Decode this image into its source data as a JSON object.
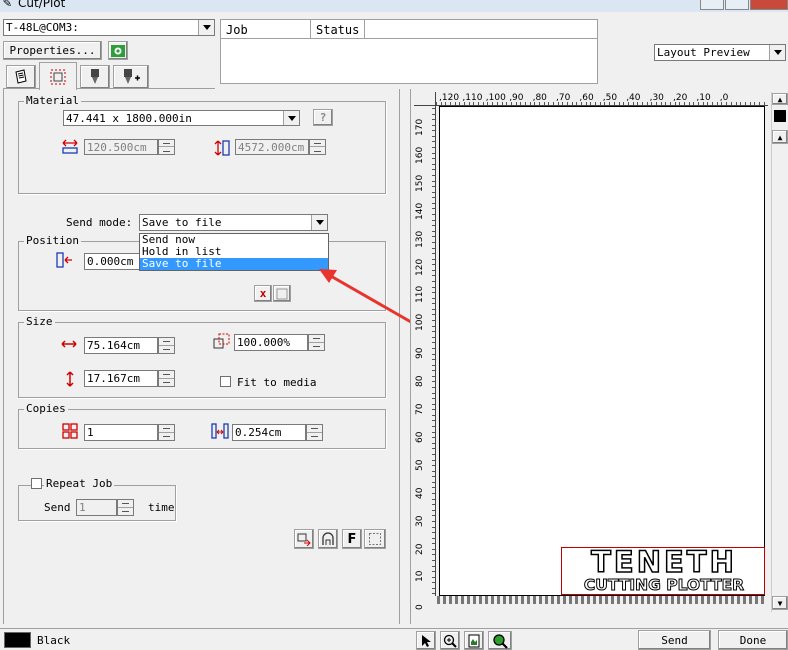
{
  "window": {
    "title": "Cut/Plot"
  },
  "device": {
    "selected": "T-48L@COM3:"
  },
  "toolbar": {
    "properties_label": "Properties..."
  },
  "queue": {
    "columns": [
      "Job",
      "Status"
    ]
  },
  "preview_mode": {
    "selected": "Layout Preview"
  },
  "material": {
    "legend": "Material",
    "size_selected": "47.441 x 1800.000in",
    "width": "120.500cm",
    "length": "4572.000cm"
  },
  "send_mode": {
    "label": "Send mode:",
    "selected": "Save to file",
    "options": [
      "Send now",
      "Hold in list",
      "Save to file"
    ]
  },
  "position": {
    "legend": "Position",
    "x": "0.000cm"
  },
  "size": {
    "legend": "Size",
    "width": "75.164cm",
    "height": "17.167cm",
    "scale": "100.000%",
    "fit_label": "Fit to media"
  },
  "copies": {
    "legend": "Copies",
    "count": "1",
    "spacing": "0.254cm"
  },
  "repeat": {
    "label": "Repeat Job",
    "send_label": "Send",
    "value": "1",
    "times_label": "times"
  },
  "ruler": {
    "horizontal": [
      ",120",
      ",110",
      ",100",
      ",90",
      ",80",
      ",70",
      ",60",
      ",50",
      ",40",
      ",30",
      ",20",
      ",10",
      ",0"
    ],
    "vertical": [
      "170",
      "160",
      "150",
      "140",
      "130",
      "120",
      "110",
      "100",
      "90",
      "80",
      "70",
      "60",
      "50",
      "40",
      "30",
      "20",
      "10",
      "0"
    ]
  },
  "artwork": {
    "line1": "TENETH",
    "line2": "CUTTING PLOTTER"
  },
  "status": {
    "color_name": "Black"
  },
  "actions": {
    "send": "Send",
    "done": "Done"
  },
  "colors": {
    "accent": "#3399ff",
    "arrow": "#e8342c",
    "artwork_border": "#c00000"
  }
}
